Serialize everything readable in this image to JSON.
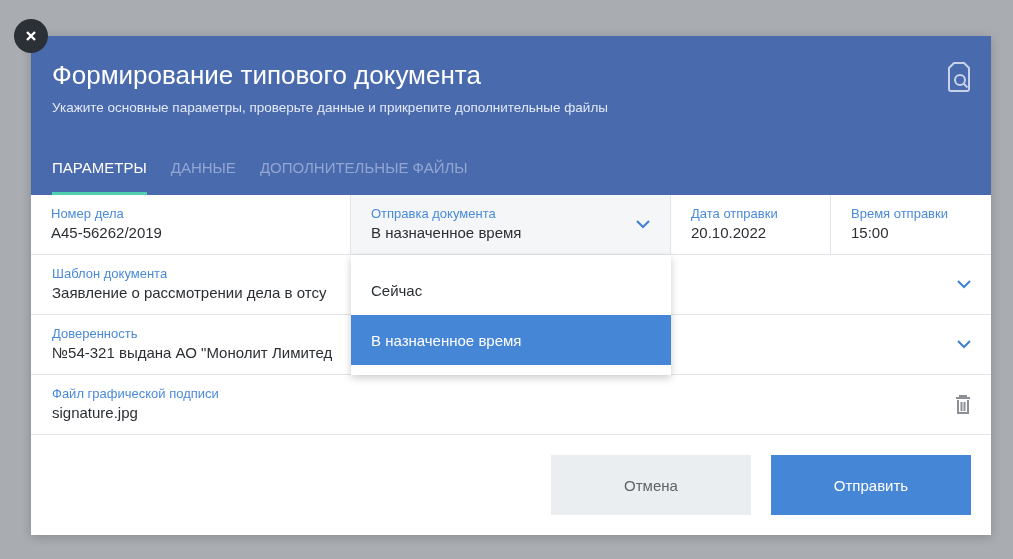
{
  "dialog": {
    "title": "Формирование типового документа",
    "subtitle": "Укажите основные параметры, проверьте данные и прикрепите дополнительные файлы"
  },
  "tabs": [
    {
      "label": "ПАРАМЕТРЫ",
      "selected": true
    },
    {
      "label": "ДАННЫЕ",
      "selected": false
    },
    {
      "label": "ДОПОЛНИТЕЛЬНЫЕ ФАЙЛЫ",
      "selected": false
    }
  ],
  "top_row": [
    {
      "label": "Номер дела",
      "value": "А45-56262/2019",
      "kind": "text"
    },
    {
      "label": "Отправка документа",
      "value": "В назначенное время",
      "kind": "select",
      "expanded": true
    },
    {
      "label": "Дата отправки",
      "value": "20.10.2022",
      "kind": "text"
    },
    {
      "label": "Время отправки",
      "value": "15:00",
      "kind": "text"
    }
  ],
  "dropdown_options": [
    {
      "label": "Сейчас",
      "selected": false
    },
    {
      "label": "В назначенное время",
      "selected": true
    }
  ],
  "rows": [
    {
      "label": "Шаблон документа",
      "value": "Заявление о рассмотрении дела в отсу",
      "kind": "select"
    },
    {
      "label": "Доверенность",
      "value": "№54-321 выдана АО \"Монолит Лимитед",
      "kind": "select"
    },
    {
      "label": "Файл графической подписи",
      "value": "signature.jpg",
      "kind": "file"
    }
  ],
  "buttons": [
    {
      "label": "Отмена",
      "kind": "secondary"
    },
    {
      "label": "Отправить",
      "kind": "primary"
    }
  ]
}
